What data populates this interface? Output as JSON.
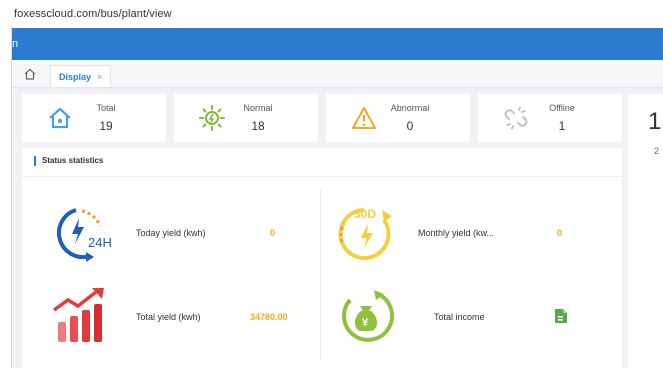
{
  "browser": {
    "url": "foxesscloud.com/bus/plant/view"
  },
  "header": {
    "caret": "n"
  },
  "tabs": [
    {
      "label": "Display",
      "close": "×"
    }
  ],
  "summary_cards": [
    {
      "label": "Total",
      "value": "19"
    },
    {
      "label": "Normal",
      "value": "18"
    },
    {
      "label": "Abnormal",
      "value": "0"
    },
    {
      "label": "Offline",
      "value": "1"
    }
  ],
  "right_panel": {
    "big": "1",
    "small": "2"
  },
  "status": {
    "title": "Status statistics",
    "today_yield": {
      "label": "Today yield (kwh)",
      "value": "0"
    },
    "monthly_yield": {
      "label": "Monthly yield (kw...",
      "value": "0"
    },
    "total_yield": {
      "label": "Total yield (kwh)",
      "value": "34780.00"
    },
    "total_income": {
      "label": "Total income"
    }
  },
  "icons": {
    "home": "home-icon",
    "normal": "sun-icon",
    "abnormal": "warning-icon",
    "offline": "broken-link-icon",
    "today": "24h-energy-icon",
    "monthly": "30d-energy-icon",
    "total": "bar-chart-up-icon",
    "income": "money-bag-icon",
    "income_value": "document-icon"
  },
  "colors": {
    "header": "#2b7bd1",
    "accent_value": "#f6a623",
    "normal_green": "#7dbb3a",
    "warning": "#f5a623",
    "home_blue": "#4aa3df"
  }
}
